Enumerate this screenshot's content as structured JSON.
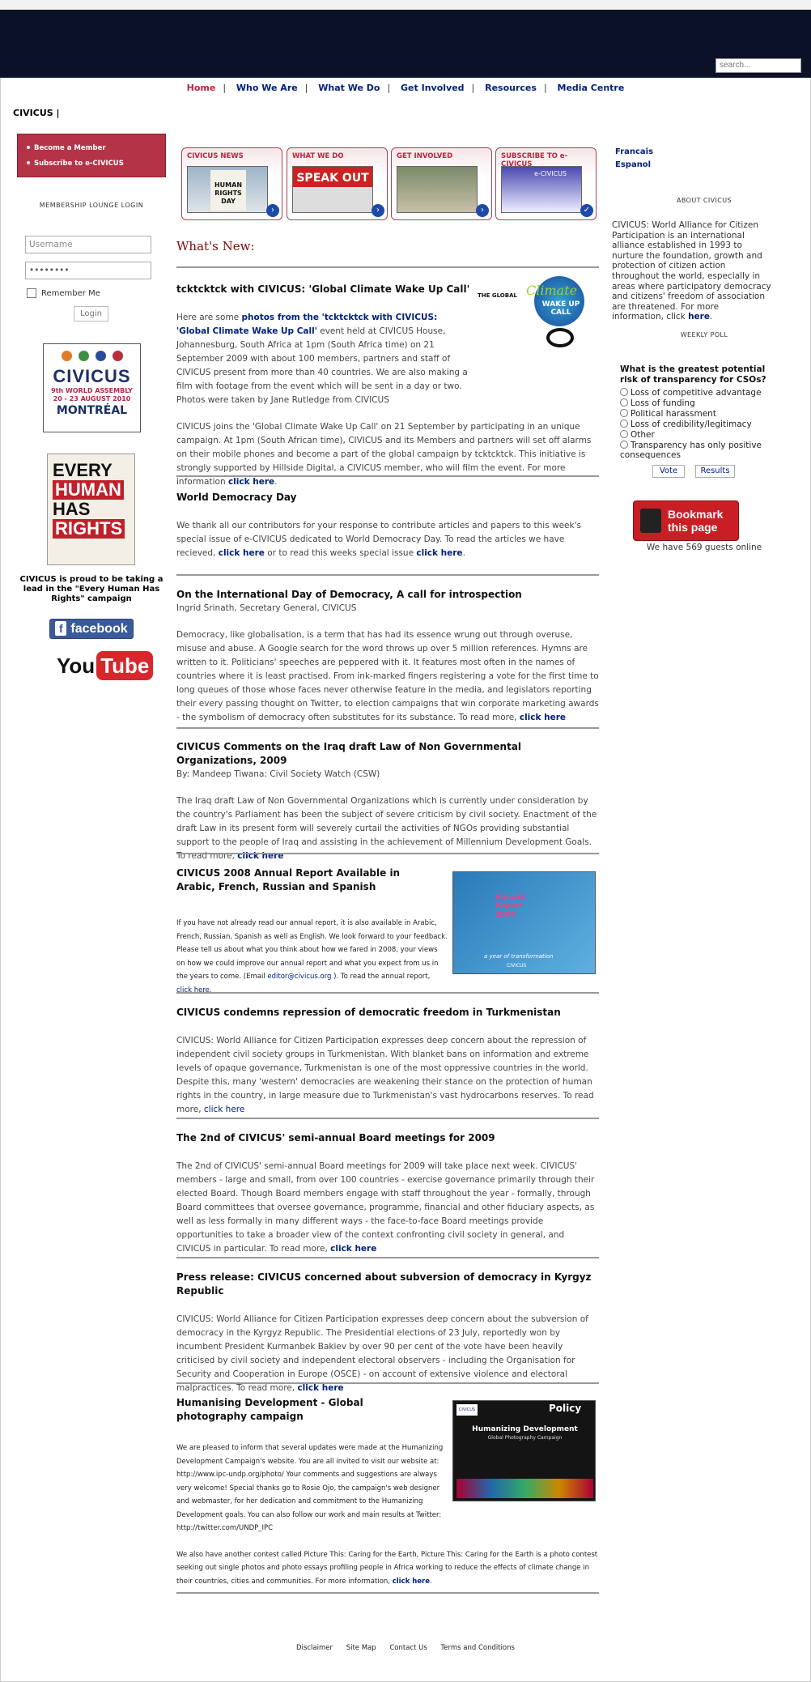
{
  "search": {
    "placeholder": "search..."
  },
  "nav": {
    "items": [
      "Home",
      "Who We Are",
      "What We Do",
      "Get Involved",
      "Resources",
      "Media Centre"
    ]
  },
  "site": {
    "name": "CIVICUS |"
  },
  "left": {
    "links": [
      "Become a Member",
      "Subscribe to e-CIVICUS"
    ],
    "lounge": "MEMBERSHIP LOUNGE LOGIN",
    "username": "Username",
    "password": "••••••••",
    "remember": "Remember Me",
    "login": "Login",
    "assembly": {
      "name": "CIVICUS",
      "line1": "9th WORLD ASSEMBLY",
      "line2": "20 - 23 AUGUST 2010",
      "city": "MONTRÉAL"
    },
    "rights": [
      "EVERY",
      "HUMAN",
      "HAS",
      "RIGHTS"
    ],
    "proud": "CIVICUS is proud to be taking a lead in the \"Every Human Has Rights\" campaign",
    "facebook": "facebook",
    "youtube_a": "You",
    "youtube_b": "Tube"
  },
  "tiles": [
    {
      "title": "CIVICUS NEWS",
      "photo": "HUMAN RIGHTS DAY"
    },
    {
      "title": "WHAT WE DO",
      "photo": "SPEAK OUT"
    },
    {
      "title": "GET INVOLVED",
      "photo": ""
    },
    {
      "title": "SUBSCRIBE TO e-CIVICUS",
      "photo": "e-CIVICUS"
    }
  ],
  "main": {
    "whatsnew": "What's New:",
    "a1": {
      "title": "tcktcktck with CIVICUS: 'Global Climate Wake Up Call'",
      "p1a": "Here are some ",
      "p1link": "photos from the 'tcktcktck with CIVICUS: 'Global Climate Wake Up Call'",
      "p1b": " event held at CIVICUS House, Johannesburg, South Africa at 1pm (South Africa time) on 21 September 2009 with about 100 members, partners and staff of CIVICUS present from more than 40 countries. We are also making a film with footage from the event which will be sent in a day or two. Photos were taken by Jane Rutledge from CIVICUS",
      "p2": "CIVICUS joins the 'Global Climate Wake Up Call' on 21 September by participating in an unique campaign. At 1pm (South African time), CIVICUS and its Members and partners will set off alarms on their mobile phones and become a part of the global campaign by tcktcktck. This initiative is strongly supported by Hillside Digital, a CIVICUS member, who will film the event. For more information ",
      "link": "click here",
      "img_a": "THE GLOBAL",
      "img_b": "Climate",
      "img_c": "WAKE UP CALL"
    },
    "a2": {
      "title": "World Democracy Day",
      "p1": "We thank all our contributors for your response to contribute articles and papers to this week's special issue of e-CIVICUS dedicated to World Democracy Day.  To read the articles we have recieved, ",
      "link1": "click here",
      "p2": " or to read this weeks special issue ",
      "link2": "click here",
      "end": "."
    },
    "a3": {
      "title": "On the International Day of Democracy, A call for introspection",
      "by": "Ingrid Srinath, Secretary General, CIVICUS",
      "p": "Democracy, like globalisation, is a term that has had its essence wrung out through overuse, misuse and abuse. A Google search for the word throws up over 5 million references. Hymns are written to it. Politicians' speeches are peppered with it. It features most often in the names of countries where it is least practised. From ink-marked fingers registering a vote for the first time to long queues of those whose faces never otherwise feature in the media, and legislators reporting their every passing thought on Twitter, to election campaigns that win corporate marketing awards - the symbolism of democracy often substitutes for its substance. To read more, ",
      "link": "click here"
    },
    "a4": {
      "title": "CIVICUS Comments on the Iraq draft Law of Non Governmental Organizations, 2009",
      "by": "By: Mandeep Tiwana: Civil Society Watch (CSW)",
      "p": "The Iraq draft Law of Non Governmental Organizations which is currently under consideration by the country's Parliament has been the subject of severe criticism by civil society. Enactment of the draft Law in its present form will severely curtail the activities of NGOs providing substantial support to the people of Iraq and assisting in the achievement of Millennium Development Goals. To read more, ",
      "link": "click here"
    },
    "a5": {
      "title": "CIVICUS 2008 Annual Report Available in Arabic, French, Russian and Spanish",
      "p": "If you have not already read our annual report, it is also available in Arabic, French, Russian, Spanish as well as English. We look forward to your feedback. Please tell us about what you think about how we fared in 2008, your views on how we could improve our annual report and what you expect from us in the years to come. (Email ",
      "email": "editor@civicus.org",
      "p2": " ). To read the annual report, ",
      "link": "click here",
      "end": ".",
      "img_a": "Annual Report 2008",
      "img_b": "a year of transformation",
      "img_c": "CIVICUS"
    },
    "a6": {
      "title": "CIVICUS condemns repression of democratic freedom in Turkmenistan",
      "p": "CIVICUS: World Alliance for Citizen Participation expresses deep concern about the repression of independent civil society groups in Turkmenistan. With blanket bans on information and extreme levels of opaque governance, Turkmenistan is one of the most oppressive countries in the world. Despite this, many 'western' democracies are weakening their stance on the protection of human rights in the country, in large measure due to Turkmenistan's vast hydrocarbons reserves. To read more, ",
      "link": "click here"
    },
    "a7": {
      "title": "The 2nd of CIVICUS' semi-annual Board meetings for 2009",
      "p": "The 2nd of CIVICUS' semi-annual Board meetings for 2009 will take place next week. CIVICUS' members - large and small, from over 100 countries - exercise governance primarily through their elected Board. Though Board members engage with staff throughout the year - formally, through Board committees that oversee governance, programme, financial and other fiduciary aspects, as well as less formally in many different ways - the face-to-face Board meetings provide opportunities to take a broader view of the context confronting civil society in general, and CIVICUS in particular. To read more, ",
      "link": "click here"
    },
    "a8": {
      "title": "Press release: CIVICUS concerned about subversion of democracy in Kyrgyz Republic",
      "p": "CIVICUS: World Alliance for Citizen Participation expresses deep concern about the subversion of democracy in the Kyrgyz Republic. The Presidential elections of 23 July, reportedly won by incumbent President Kurmanbek Bakiev by over 90 per cent of the vote have been heavily criticised by civil society and independent electoral observers - including the Organisation for Security and Cooperation in Europe (OSCE) - on account of extensive violence and electoral malpractices. To read more, ",
      "link": "click here"
    },
    "a9": {
      "title": "Humanising Development - Global photography campaign",
      "p": "We are pleased to inform that several updates were made at the Humanizing Development Campaign's website. You are all invited to visit our website at: http://www.ipc-undp.org/photo/ Your comments and suggestions are always very welcome! Special thanks go to Rosie Ojo, the campaign's web designer and webmaster, for her dedication and commitment to the Humanizing Development goals. You can also follow our work and main results at Twitter: http://twitter.com/UNDP_IPC",
      "p2": "We also have another contest called Picture This: Caring for the Earth, Picture This: Caring for the Earth is a photo contest seeking out single photos and photo essays profiling people in Africa working to reduce the effects of climate change in their countries, cities and communities. For more information, ",
      "link": "click here",
      "end": ".",
      "img_a": "Humanizing Development",
      "img_b": "Global Photography Campaign",
      "img_c": "Policy",
      "img_d": "CIVICUS"
    }
  },
  "right": {
    "langs": [
      "Francais",
      "Espanol"
    ],
    "about_head": "ABOUT CIVICUS",
    "about": "CIVICUS: World Alliance for Citizen Participation is an international alliance established in 1993 to nurture the foundation, growth and protection of citizen action throughout the world, especially in areas where participatory democracy and citizens' freedom of association are threatened. For more information, click ",
    "about_link": "here",
    "about_end": ".",
    "poll_head": "WEEKLY POLL",
    "poll_q": "What is the greatest potential risk of transparency for CSOs?",
    "options": [
      "Loss of competitive advantage",
      "Loss of funding",
      "Political harassment",
      "Loss of credibility/legitimacy",
      "Other",
      "Transparency has only positive consequences"
    ],
    "vote": "Vote",
    "results": "Results",
    "bookmark": "Bookmark this page",
    "guests": "We have 569 guests online"
  },
  "footer": [
    "Disclaimer",
    "Site Map",
    "Contact Us",
    "Terms and Conditions"
  ],
  "colors": {
    "topbar": "#0b1127",
    "accent": "#c0213c",
    "link": "#00217c",
    "left_box": "#b43346"
  }
}
